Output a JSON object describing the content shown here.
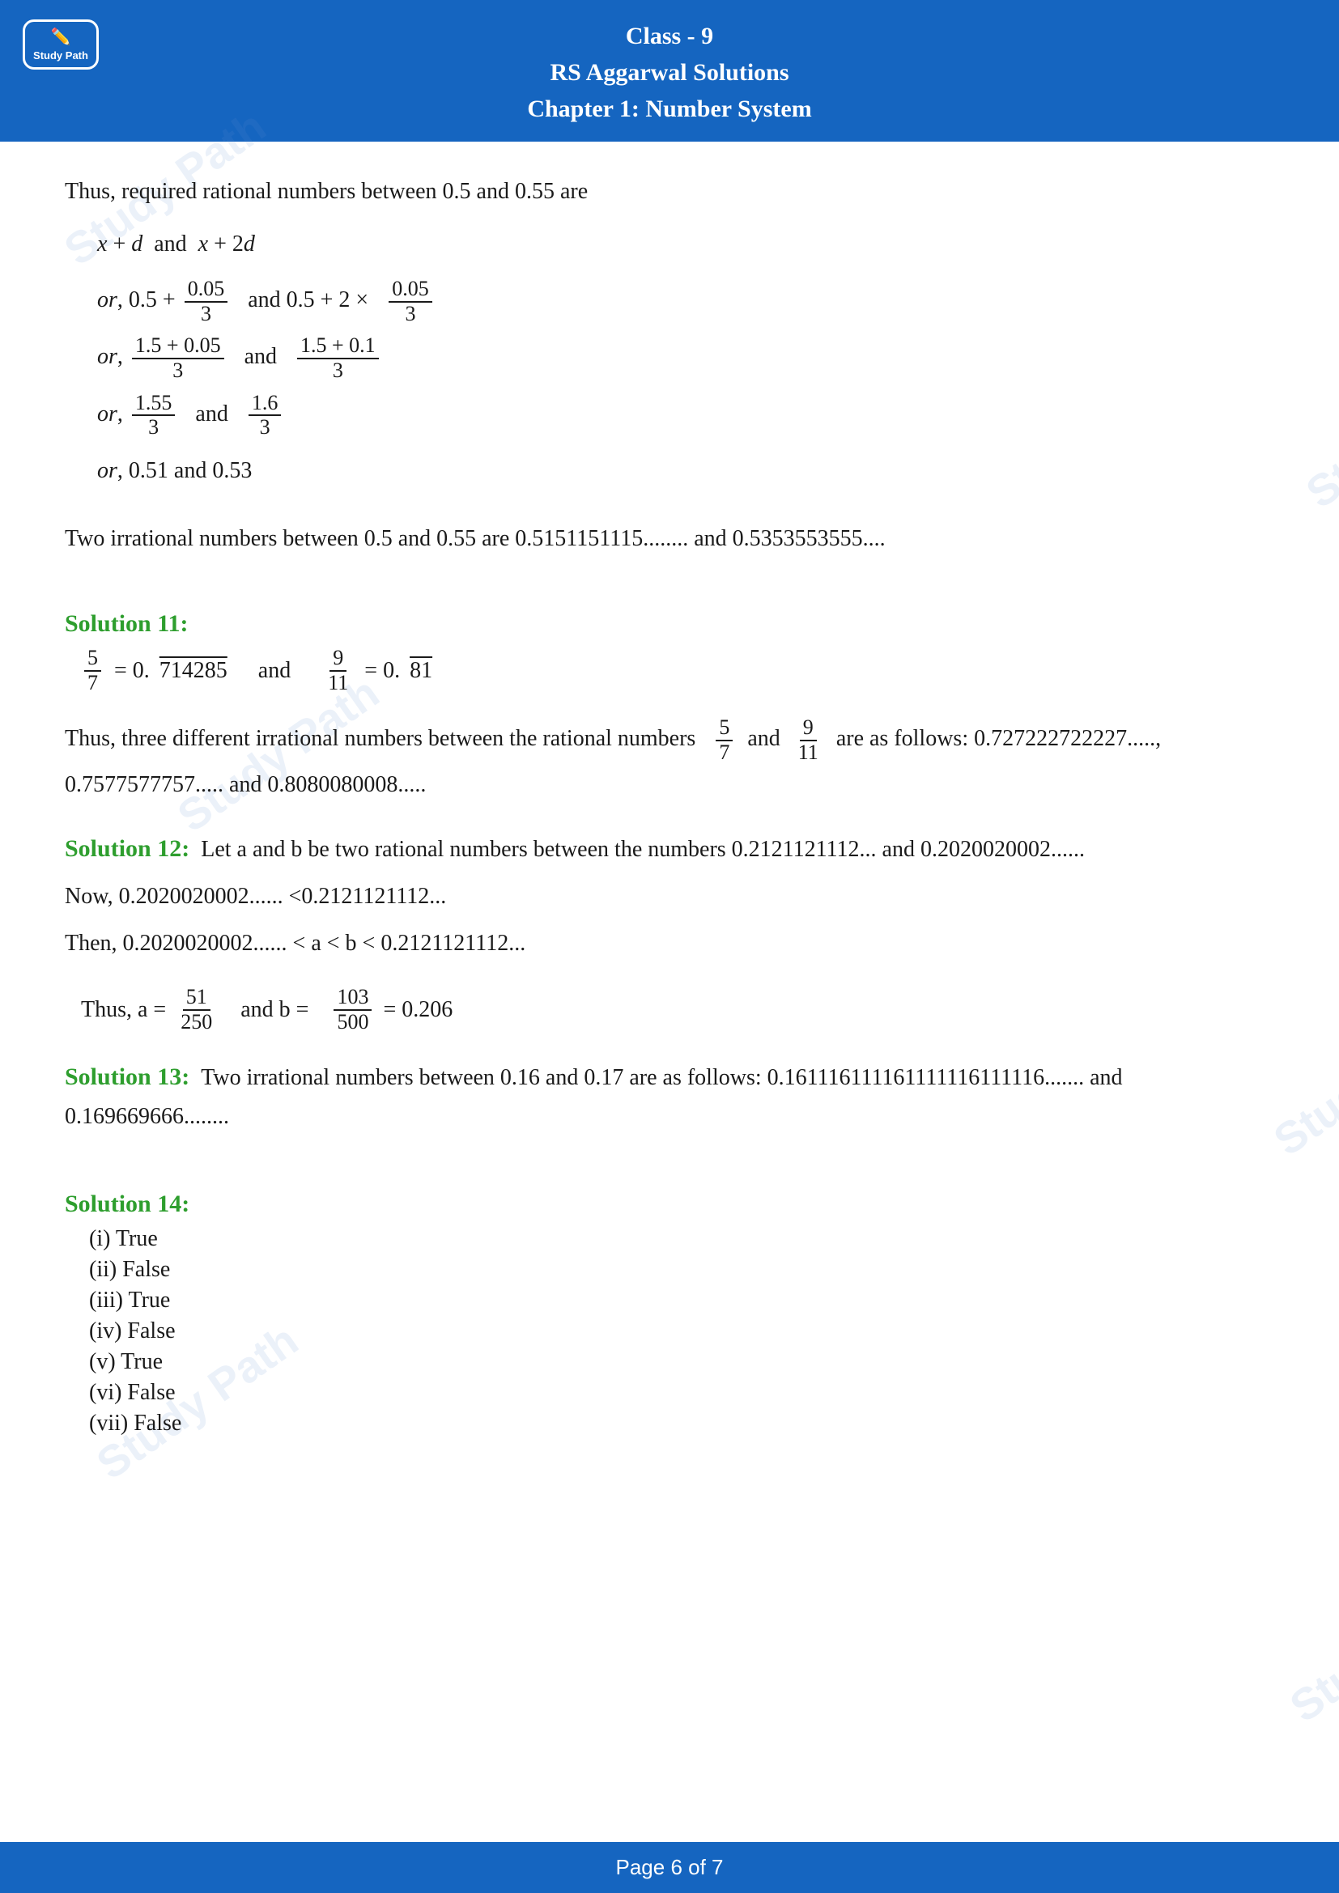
{
  "header": {
    "line1": "Class - 9",
    "line2": "RS Aggarwal Solutions",
    "line3": "Chapter 1: Number System"
  },
  "logo": {
    "text": "Study Path"
  },
  "footer": {
    "text": "Page 6 of 7"
  },
  "content": {
    "intro_text": "Thus, required rational numbers between 0.5 and 0.55 are",
    "xd_line": "x + d and x + 2d",
    "or1_text": "or, 0.5 +",
    "or1_num": "0.05",
    "or1_den": "3",
    "or1_and": "and  0.5 + 2 ×",
    "or1_num2": "0.05",
    "or1_den2": "3",
    "or2_text": "or,",
    "or2_num": "1.5 + 0.05",
    "or2_den": "3",
    "or2_and": "and",
    "or2_num2": "1.5 + 0.1",
    "or2_den2": "3",
    "or3_text": "or,",
    "or3_num": "1.55",
    "or3_den": "3",
    "or3_and": "and",
    "or3_num2": "1.6",
    "or3_den2": "3",
    "or4_text": "or, 0.51 and 0.53",
    "irrational_text": "Two irrational numbers between 0.5 and 0.55 are 0.5151151115........ and 0.5353553555....",
    "sol11_heading": "Solution 11:",
    "sol11_frac1_num": "5",
    "sol11_frac1_den": "7",
    "sol11_eq1": "= 0.",
    "sol11_overline1": "714285",
    "sol11_and": "and",
    "sol11_frac2_num": "9",
    "sol11_frac2_den": "11",
    "sol11_eq2": "= 0.",
    "sol11_overline2": "81",
    "sol11_text1": "Thus, three different irrational numbers between the rational numbers",
    "sol11_frac3_num": "5",
    "sol11_frac3_den": "7",
    "sol11_text2": "and",
    "sol11_frac4_num": "9",
    "sol11_frac4_den": "11",
    "sol11_text3": "are as follows: 0.727222722227....., 0.7577577757..... and 0.8080080008.....",
    "sol12_heading": "Solution 12:",
    "sol12_text1": "Let a and b be two rational numbers between the numbers 0.2121121112... and 0.2020020002......",
    "sol12_text2": "Now, 0.2020020002...... <0.2121121112...",
    "sol12_text3": "Then, 0.2020020002...... < a < b < 0.2121121112...",
    "sol12_thus": "Thus, a =",
    "sol12_a_num": "51",
    "sol12_a_den": "250",
    "sol12_and_b": "and  b =",
    "sol12_b_num": "103",
    "sol12_b_den": "500",
    "sol12_b_eq": "= 0.206",
    "sol13_heading": "Solution 13:",
    "sol13_text": "Two irrational numbers between 0.16 and 0.17 are as follows: 0.161116111161111116111116....... and 0.169669666........",
    "sol14_heading": "Solution 14:",
    "sol14_items": [
      "(i) True",
      "(ii) False",
      "(iii) True",
      "(iv) False",
      "(v) True",
      "(vi) False",
      "(vii) False"
    ]
  }
}
